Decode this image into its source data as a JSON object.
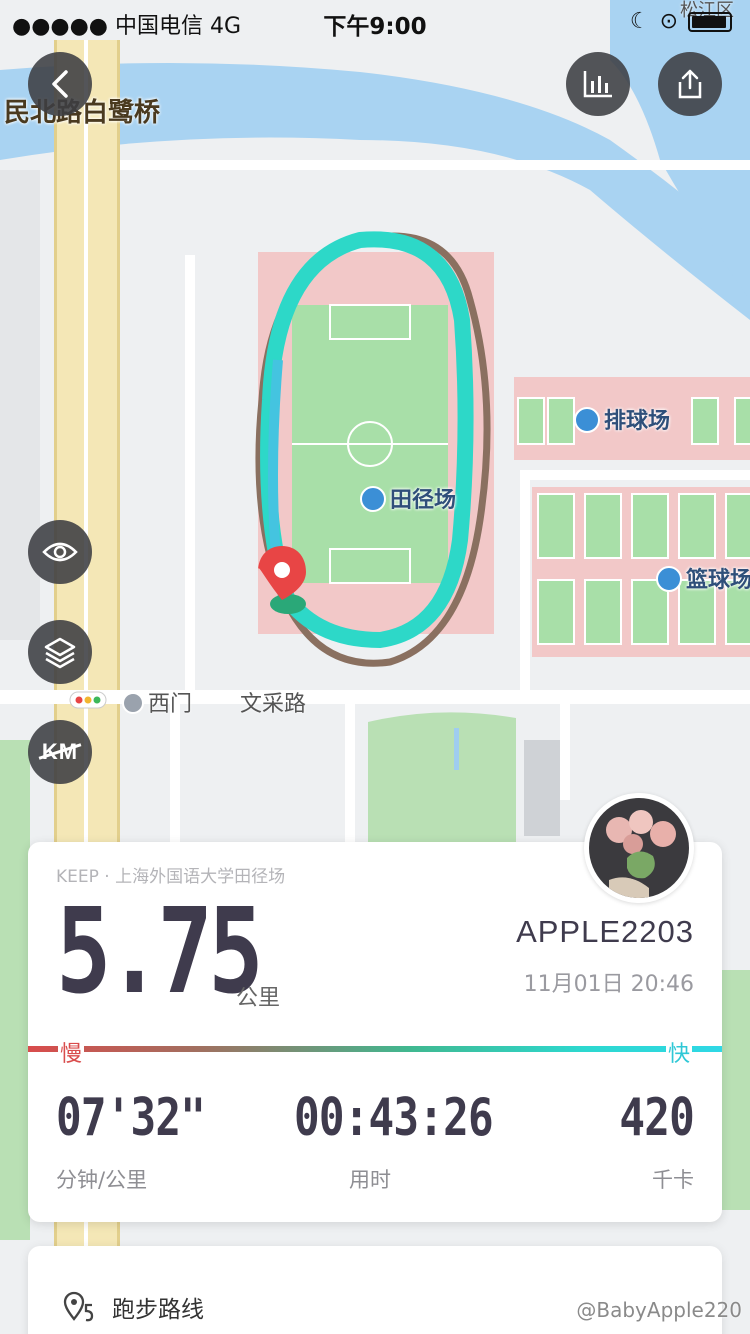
{
  "status_bar": {
    "signal": "●●●●● 中国电信  4G",
    "time": "下午9:00"
  },
  "map": {
    "road_label": "民北路白鹭桥",
    "corner_label": "松江区",
    "volleyball_label": "排球场",
    "track_label": "田径场",
    "basketball_label": "篮球场",
    "gate_label": "西门",
    "street_label": "文采路"
  },
  "toolbar": {
    "km_label": "KM"
  },
  "run_card": {
    "source": "KEEP · 上海外国语大学田径场",
    "distance": "5.75",
    "distance_unit": "公里",
    "user_name": "APPLE2203",
    "datetime": "11月01日 20:46",
    "slow_label": "慢",
    "fast_label": "快",
    "stats": {
      "pace_value": "07'32\"",
      "pace_label": "分钟/公里",
      "duration_value": "00:43:26",
      "duration_label": "用时",
      "calories_value": "420",
      "calories_label": "千卡"
    }
  },
  "route_section": {
    "label": "跑步路线"
  },
  "watermark": "@BabyApple220",
  "colors": {
    "route_fast": "#2dd8c8",
    "route_slow": "#8a6a5a",
    "slow": "#d94c4c",
    "fast": "#2fc8d6",
    "text_dark": "#3f3b4d"
  }
}
